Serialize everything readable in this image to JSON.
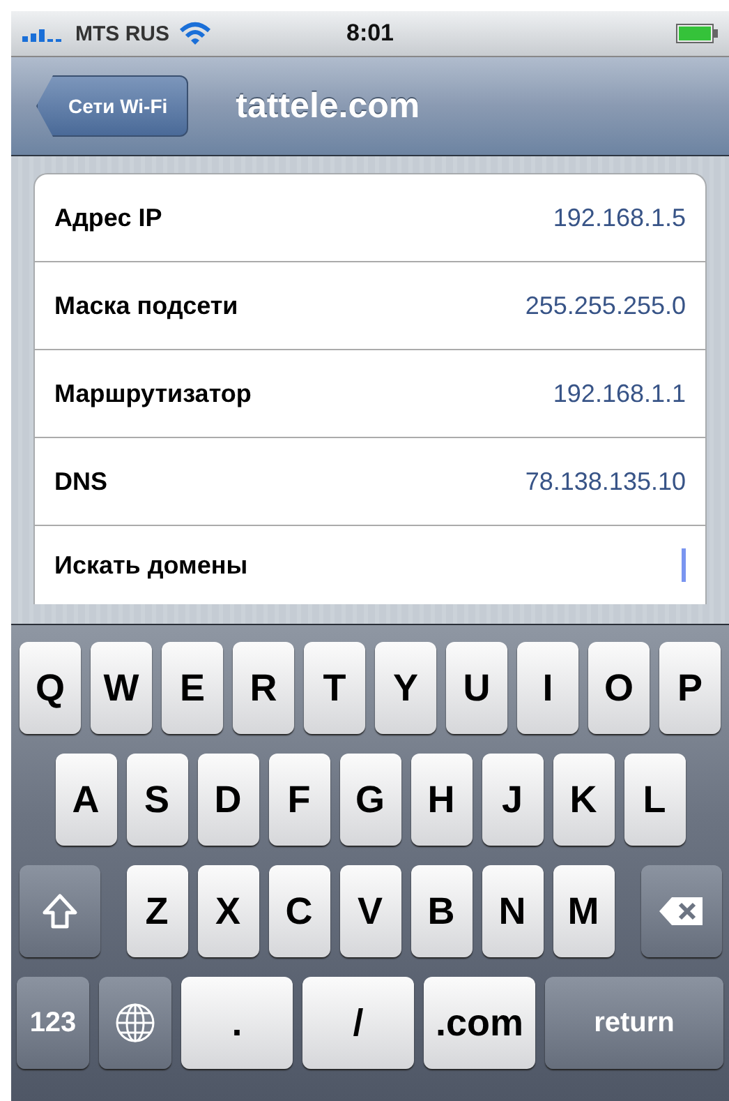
{
  "status_bar": {
    "carrier": "MTS RUS",
    "time": "8:01"
  },
  "nav_bar": {
    "back": "Сети Wi-Fi",
    "title": "tattele.com"
  },
  "rows": [
    {
      "label": "Адрес IP",
      "value": "192.168.1.5"
    },
    {
      "label": "Маска подсети",
      "value": "255.255.255.0"
    },
    {
      "label": "Маршрутизатор",
      "value": "192.168.1.1"
    },
    {
      "label": "DNS",
      "value": "78.138.135.10"
    }
  ],
  "field_row": {
    "label": "Искать домены"
  },
  "keyboard": [
    [
      {
        "kind": "letter",
        "label": "Q"
      },
      {
        "kind": "letter",
        "label": "W"
      },
      {
        "kind": "letter",
        "label": "E"
      },
      {
        "kind": "letter",
        "label": "R"
      },
      {
        "kind": "letter",
        "label": "T"
      },
      {
        "kind": "letter",
        "label": "Y"
      },
      {
        "kind": "letter",
        "label": "U"
      },
      {
        "kind": "letter",
        "label": "I"
      },
      {
        "kind": "letter",
        "label": "O"
      },
      {
        "kind": "letter",
        "label": "P"
      }
    ],
    [
      {
        "kind": "letter",
        "label": "A"
      },
      {
        "kind": "letter",
        "label": "S"
      },
      {
        "kind": "letter",
        "label": "D"
      },
      {
        "kind": "letter",
        "label": "F"
      },
      {
        "kind": "letter",
        "label": "G"
      },
      {
        "kind": "letter",
        "label": "H"
      },
      {
        "kind": "letter",
        "label": "J"
      },
      {
        "kind": "letter",
        "label": "K"
      },
      {
        "kind": "letter",
        "label": "L"
      }
    ],
    [
      {
        "kind": "shift"
      },
      {
        "kind": "letter",
        "label": "Z"
      },
      {
        "kind": "letter",
        "label": "X"
      },
      {
        "kind": "letter",
        "label": "C"
      },
      {
        "kind": "letter",
        "label": "V"
      },
      {
        "kind": "letter",
        "label": "B"
      },
      {
        "kind": "letter",
        "label": "N"
      },
      {
        "kind": "letter",
        "label": "M"
      },
      {
        "kind": "delete"
      }
    ],
    [
      {
        "kind": "mode",
        "label": "123"
      },
      {
        "kind": "globe"
      },
      {
        "kind": "wide",
        "label": "."
      },
      {
        "kind": "wide",
        "label": "/"
      },
      {
        "kind": "wide",
        "label": ".com"
      },
      {
        "kind": "return",
        "label": "return"
      }
    ]
  ]
}
